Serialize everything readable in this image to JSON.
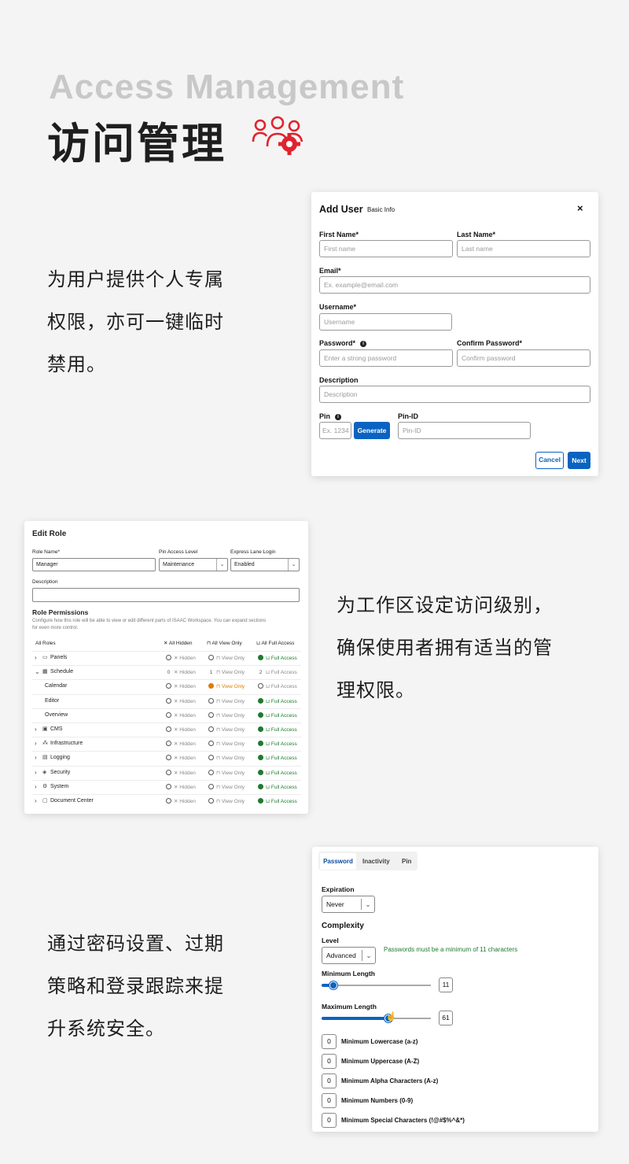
{
  "header": {
    "title_en": "Access Management",
    "title_zh": "访问管理",
    "icon": "users-gear-icon",
    "accent": "#e0232e"
  },
  "section1": {
    "desc_lines": [
      "为用户提供个人专属",
      "权限，亦可一键临时",
      "禁用。"
    ],
    "dialog": {
      "title": "Add User",
      "subtitle": "Basic Info",
      "close": "×",
      "first_name_label": "First Name*",
      "first_name_placeholder": "First name",
      "last_name_label": "Last Name*",
      "last_name_placeholder": "Last name",
      "email_label": "Email*",
      "email_placeholder": "Ex. example@email.com",
      "username_label": "Username*",
      "username_placeholder": "Username",
      "password_label": "Password*",
      "password_placeholder": "Enter a strong password",
      "confirm_label": "Confirm Password*",
      "confirm_placeholder": "Confirm password",
      "description_label": "Description",
      "description_placeholder": "Description",
      "pin_label": "Pin",
      "pin_placeholder": "Ex. 1234",
      "generate": "Generate",
      "pinid_label": "Pin-ID",
      "pinid_placeholder": "Pin-ID",
      "cancel": "Cancel",
      "next": "Next"
    }
  },
  "section2": {
    "desc_lines": [
      "为工作区设定访问级别，",
      "确保使用者拥有适当的管",
      "理权限。"
    ],
    "role": {
      "title": "Edit Role",
      "role_name_label": "Role Name*",
      "role_name_value": "Manager",
      "pin_level_label": "Pin Access Level",
      "pin_level_value": "Maintenance",
      "express_label": "Express Lane Login",
      "express_value": "Enabled",
      "description_label": "Description",
      "permissions_title": "Role Permissions",
      "permissions_desc_1": "Configure how this role will be able to view or edit different parts of ISAAC Workspace. You can expand sections",
      "permissions_desc_2": "for even more control.",
      "all_roles": "All Roles",
      "all_hidden": "All Hidden",
      "all_view": "All View Only",
      "all_full": "All Full Access",
      "hidden": "Hidden",
      "view_only": "View Only",
      "full_access": "Full Access",
      "rows": [
        {
          "name": "Panels",
          "expand": "›",
          "icon": "▭",
          "state": "full"
        },
        {
          "name": "Schedule",
          "expand": "⌄",
          "icon": "▦",
          "state": "mixed",
          "n_hidden": "0",
          "n_view": "1",
          "n_full": "2"
        },
        {
          "name": "Calendar",
          "sub": true,
          "state": "view"
        },
        {
          "name": "Editor",
          "sub": true,
          "state": "full"
        },
        {
          "name": "Overview",
          "sub": true,
          "state": "full"
        },
        {
          "name": "CMS",
          "expand": "›",
          "icon": "▣",
          "state": "full"
        },
        {
          "name": "Infrastructure",
          "expand": "›",
          "icon": "⁂",
          "state": "full"
        },
        {
          "name": "Logging",
          "expand": "›",
          "icon": "▤",
          "state": "full"
        },
        {
          "name": "Security",
          "expand": "›",
          "icon": "◈",
          "state": "full"
        },
        {
          "name": "System",
          "expand": "›",
          "icon": "⚙",
          "state": "full"
        },
        {
          "name": "Document Center",
          "expand": "›",
          "icon": "▢",
          "state": "full"
        }
      ]
    }
  },
  "section3": {
    "desc_lines": [
      "通过密码设置、过期",
      "策略和登录跟踪来提",
      "升系统安全。"
    ],
    "pw": {
      "tabs": [
        "Password",
        "Inactivity",
        "Pin"
      ],
      "expiration_label": "Expiration",
      "expiration_value": "Never",
      "complexity_title": "Complexity",
      "level_label": "Level",
      "level_value": "Advanced",
      "hint": "Passwords must be a minimum of 11 characters",
      "min_length_label": "Minimum Length",
      "min_length": 11,
      "min_length_fraction": 0.11,
      "max_length_label": "Maximum Length",
      "max_length": 61,
      "max_length_fraction": 0.61,
      "counters": [
        {
          "value": "0",
          "label": "Minimum Lowercase (a-z)"
        },
        {
          "value": "0",
          "label": "Minimum Uppercase (A-Z)"
        },
        {
          "value": "0",
          "label": "Minimum Alpha Characters (A-z)"
        },
        {
          "value": "0",
          "label": "Minimum Numbers (0-9)"
        },
        {
          "value": "0",
          "label": "Minimum Special Characters (!@#$%^&*)"
        }
      ]
    }
  }
}
